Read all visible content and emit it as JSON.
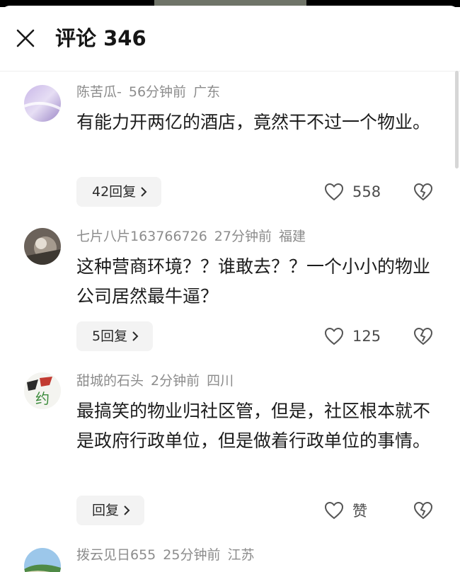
{
  "header": {
    "title": "评论 346"
  },
  "comments": [
    {
      "username": "陈苦瓜-",
      "time": "56分钟前",
      "location": "广东",
      "text": "有能力开两亿的酒店，竟然干不过一个物业。",
      "reply_label": "42回复",
      "likes": "558"
    },
    {
      "username": "七片八片163766726",
      "time": "27分钟前",
      "location": "福建",
      "text": "这种营商环境？？谁敢去？？一个小小的物业公司居然最牛逼？",
      "reply_label": "5回复",
      "likes": "125"
    },
    {
      "username": "甜城的石头",
      "time": "2分钟前",
      "location": "四川",
      "text": "最搞笑的物业归社区管，但是，社区根本就不是政府行政单位，但是做着行政单位的事情。",
      "reply_label": "回复",
      "likes": "赞",
      "avatar_text": "约"
    },
    {
      "username": "拨云见日655",
      "time": "25分钟前",
      "location": "江苏"
    }
  ],
  "colors": {
    "meta": "#8c8c8c",
    "reply_bg": "#f3f3f3",
    "text": "#1c1c1c"
  }
}
